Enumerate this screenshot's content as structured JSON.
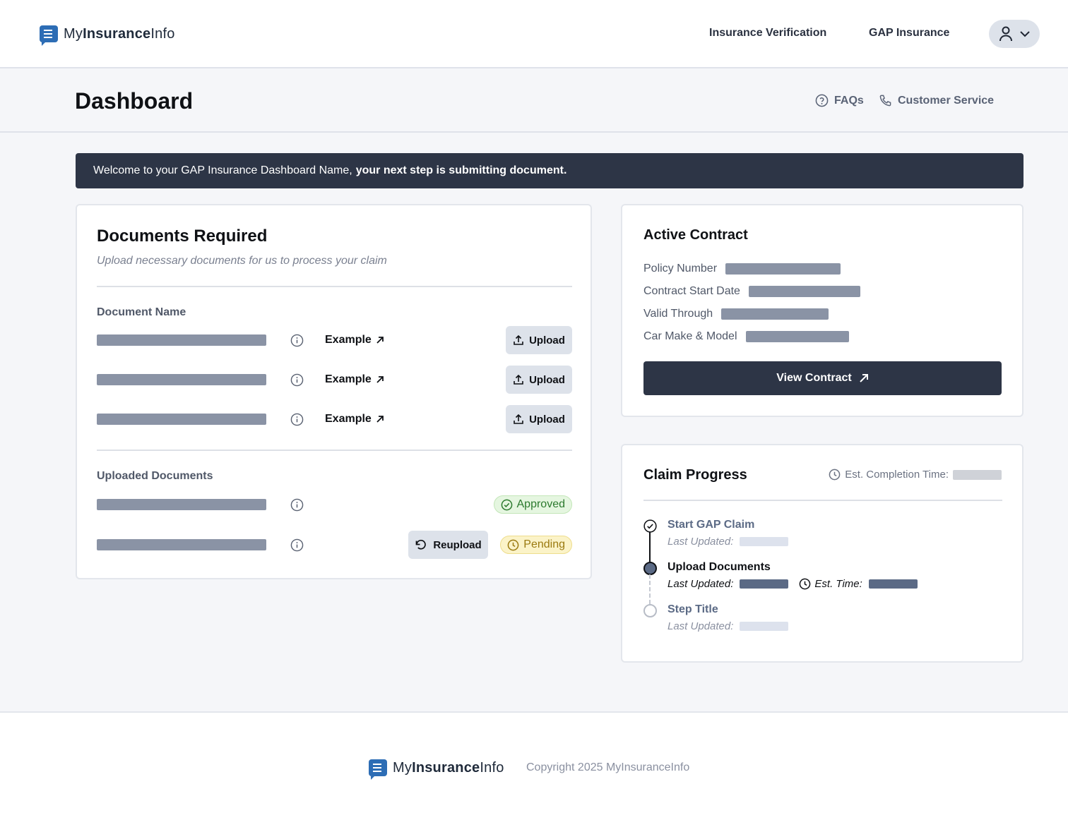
{
  "brand": {
    "name_prefix": "My",
    "name_bold": "Insurance",
    "name_suffix": "Info"
  },
  "nav": {
    "items": [
      "Insurance Verification",
      "GAP Insurance"
    ]
  },
  "header": {
    "title": "Dashboard",
    "faq": "FAQs",
    "customer_service": "Customer Service"
  },
  "banner": {
    "text": "Welcome to your GAP Insurance Dashboard Name,",
    "bold": "your next step is submitting document."
  },
  "documents": {
    "title": "Documents Required",
    "subtitle": "Upload necessary documents for us to process your claim",
    "required_label": "Document Name",
    "example_label": "Example",
    "upload_label": "Upload",
    "uploaded_label": "Uploaded Documents",
    "approved_label": "Approved",
    "pending_label": "Pending",
    "reupload_label": "Reupload"
  },
  "contract": {
    "title": "Active Contract",
    "fields": [
      "Policy Number",
      "Contract Start Date",
      "Valid Through",
      "Car Make & Model"
    ],
    "view_button": "View Contract"
  },
  "claim": {
    "title": "Claim Progress",
    "est_completion": "Est. Completion Time:",
    "steps": [
      {
        "title": "Start GAP Claim",
        "last_updated": "Last Updated:",
        "status": "complete"
      },
      {
        "title": "Upload Documents",
        "last_updated": "Last Updated:",
        "est_time": "Est. Time:",
        "status": "current"
      },
      {
        "title": "Step Title",
        "last_updated": "Last Updated:",
        "status": "upcoming"
      }
    ]
  },
  "footer": {
    "copyright": "Copyright 2025 MyInsuranceInfo"
  },
  "colors": {
    "navy": "#2d3546",
    "accent": "#2d6db5",
    "placeholder": "#8a93a5",
    "approved": "#2c7a2e",
    "pending": "#9b7a10"
  },
  "icons": [
    "user-icon",
    "chevron-down-icon",
    "help-circle-icon",
    "phone-icon",
    "info-icon",
    "arrow-up-right-icon",
    "upload-icon",
    "check-circle-icon",
    "clock-icon",
    "rotate-ccw-icon",
    "check-icon"
  ]
}
